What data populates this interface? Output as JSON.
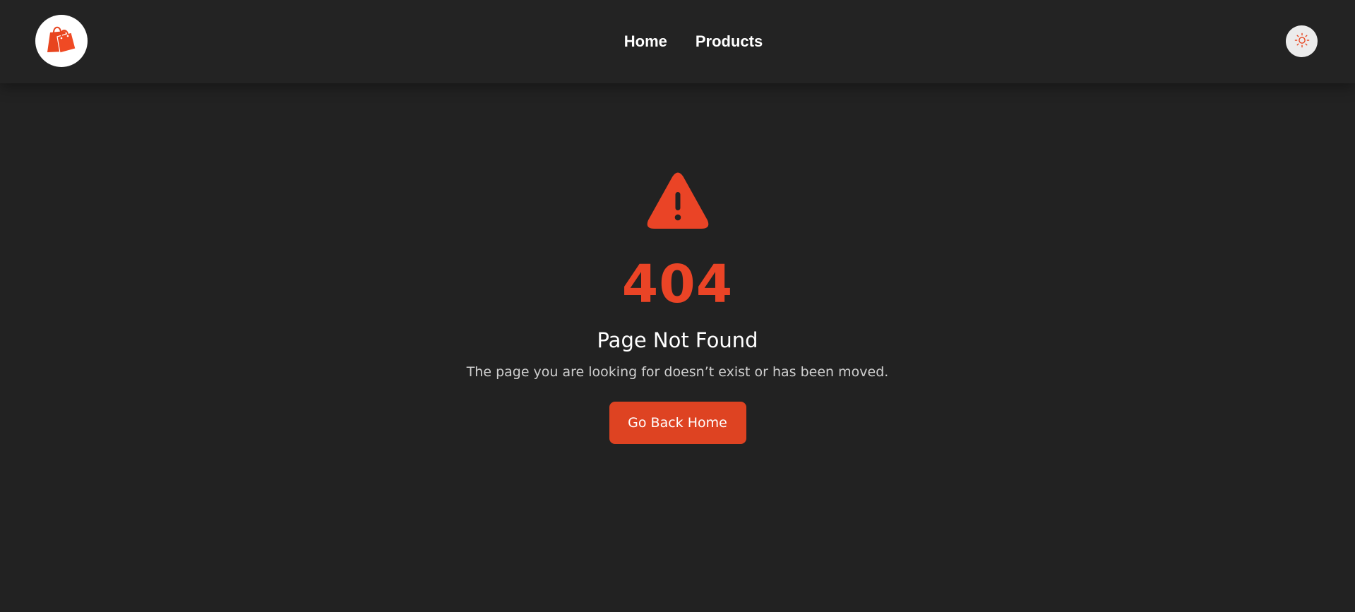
{
  "header": {
    "logo_icon": "shopping-bags-icon",
    "nav": [
      {
        "label": "Home"
      },
      {
        "label": "Products"
      }
    ],
    "theme_toggle_icon": "sun-icon"
  },
  "error": {
    "icon": "warning-triangle-icon",
    "code": "404",
    "title": "Page Not Found",
    "message": "The page you are looking for doesn’t exist or has been moved.",
    "button_label": "Go Back Home"
  },
  "colors": {
    "accent": "#ea4426",
    "background": "#222222",
    "header": "#232323",
    "button": "#de4322"
  }
}
